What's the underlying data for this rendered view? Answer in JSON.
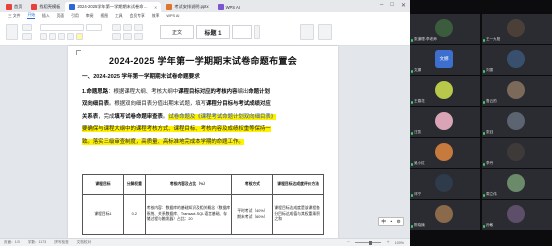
{
  "tabs": [
    {
      "label": "首页",
      "color": "#e8413c"
    },
    {
      "label": "找稻壳模板",
      "color": "#e8413c"
    },
    {
      "label": "2024-2025学年第一学期期末试卷命题布置会",
      "color": "#2b6ad6",
      "active": true
    },
    {
      "label": "考试安排说明.pptx",
      "color": "#e0742c"
    },
    {
      "label": "WPS AI",
      "color": "#7a57d1"
    }
  ],
  "ribbon_tabs": [
    "三 文件",
    "开始",
    "插入",
    "页面",
    "引用",
    "审阅",
    "视图",
    "工具",
    "会员专享",
    "效率",
    "WPS AI"
  ],
  "ribbon": {
    "style_label": "标题 1"
  },
  "document": {
    "title": "2024-2025 学年第一学期期末试卷命题布置会",
    "heading": "一、2024-2025 学年第一学期期末试卷命题要求",
    "lines": [
      [
        {
          "t": "1.命题思路",
          "b": true
        },
        {
          "t": "：根据课程大纲、考核大纲中"
        },
        {
          "t": "课程目标对应的考核内容",
          "b": true
        },
        {
          "t": "编出"
        },
        {
          "t": "命题计划",
          "b": true
        }
      ],
      [
        {
          "t": "双向细目表",
          "b": true
        },
        {
          "t": "。根据双向细目表分值出期末试题，填写"
        },
        {
          "t": "课程分目标与考试成绩对应",
          "b": true
        }
      ],
      [
        {
          "t": "关系表",
          "b": true
        },
        {
          "t": "，完成"
        },
        {
          "t": "填写试卷命题审查表",
          "b": true
        },
        {
          "t": "。"
        },
        {
          "t": "试卷命题及《课程考试命题计划双向细目表》",
          "h": "blue"
        }
      ],
      [
        {
          "t": "要确保与课程大纲中的课程考核方式、课程目标、考核内容及成绩权重等保持一",
          "h": "yellow"
        }
      ],
      [
        {
          "t": "致。落实三级审查制度，高质量、高标准地完成本学期的命题工作。",
          "h": "yellow"
        }
      ]
    ],
    "table": {
      "headers": [
        "课程目标",
        "分解权重",
        "考核内容及占比（%）",
        "考核方式",
        "课程目标达成度评价方法"
      ],
      "row": [
        "课程目标1",
        "0.2",
        "考核内容：数据库的基础知识及相关概念（数据库系统、关系数据库、Transact-SQL语言基础、存储过程与触发器）占比：20",
        "平时考试（40%）\n期末考试（60%）",
        "课程目标达成度是该课程各分目标达成值与其权重乘积之和"
      ]
    }
  },
  "statusbar": {
    "left": [
      "页面：1/3",
      "字数：1173",
      "拼写检查",
      "文档校对"
    ],
    "zoom": "100%"
  },
  "ime": {
    "label": "中",
    "icon": "dot-icon"
  },
  "participants": [
    {
      "name": "张道理-李老师",
      "avatar": "photo",
      "color": "#3b5d3d"
    },
    {
      "name": "王一九阳",
      "avatar": "photo",
      "color": "#4a4038"
    },
    {
      "name": "文娜",
      "avatar": "text",
      "color": "#3d6fcf",
      "text": "文娜"
    },
    {
      "name": "刘振",
      "avatar": "photo",
      "color": "#38506e"
    },
    {
      "name": "王春花",
      "avatar": "photo",
      "color": "#b7c84a"
    },
    {
      "name": "鲁云的",
      "avatar": "photo",
      "color": "#7b6a5a"
    },
    {
      "name": "汪凯",
      "avatar": "photo",
      "color": "#d9a4b6"
    },
    {
      "name": "张钰",
      "avatar": "photo",
      "color": "#5b6470"
    },
    {
      "name": "吴小红",
      "avatar": "photo",
      "color": "#c67a3d"
    },
    {
      "name": "李丹",
      "avatar": "photo",
      "color": "#3f3a3a"
    },
    {
      "name": "邓宁",
      "avatar": "photo",
      "color": "#2f3a4a"
    },
    {
      "name": "周立伟",
      "avatar": "photo",
      "color": "#6a8a6a"
    },
    {
      "name": "陈晓楠",
      "avatar": "photo",
      "color": "#8a6a4a"
    },
    {
      "name": "孙敏",
      "avatar": "photo",
      "color": "#5d4e6a"
    }
  ]
}
